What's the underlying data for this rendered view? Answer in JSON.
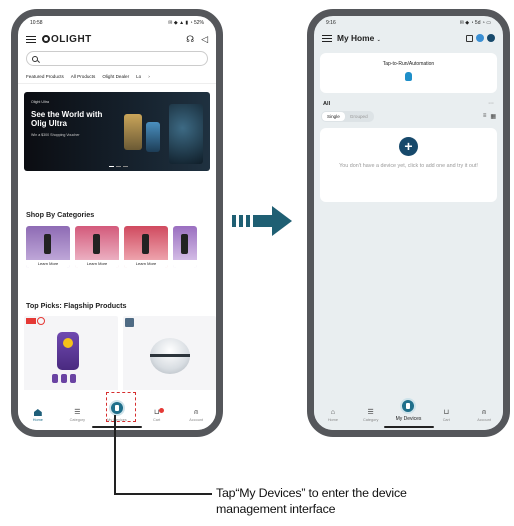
{
  "left_phone": {
    "status": {
      "time": "10:58",
      "icons": "✉ ◆ ▲ ▮ ◔ 52%"
    },
    "logo": "OLIGHT",
    "tabs": [
      "Featured Products",
      "All Products",
      "Olight Dealer",
      "Lo"
    ],
    "banner": {
      "brand": "Olight Ultra",
      "title": "See the World with Olig Ultra",
      "subtitle": "Win a $300 Shopping Voucher"
    },
    "shop_title": "Shop By Categories",
    "learn_more": "Learn More",
    "picks_title": "Top Picks: Flagship Products",
    "nav": [
      {
        "icon": "home-icon",
        "label": "Home"
      },
      {
        "icon": "category-icon",
        "label": "Category"
      },
      {
        "icon": "devices-icon",
        "label": "My Devices"
      },
      {
        "icon": "cart-icon",
        "label": "Cart"
      },
      {
        "icon": "account-icon",
        "label": "Account"
      }
    ]
  },
  "right_phone": {
    "status": {
      "time": "9:16",
      "icons": "✉ ◆ ◔ 5d ◔ ▭"
    },
    "title": "My Home",
    "tap_card_label": "Tap-to-Run/Automation",
    "all_label": "All",
    "more": "···",
    "segments": [
      "Single",
      "Grouped"
    ],
    "empty_text": "You don't have a device yet, click to add one and try it out!",
    "plus": "+",
    "nav": [
      {
        "icon": "home-icon",
        "label": "Home"
      },
      {
        "icon": "category-icon",
        "label": "Category"
      },
      {
        "icon": "devices-icon",
        "label": "My Devices"
      },
      {
        "icon": "cart-icon",
        "label": "Cart"
      },
      {
        "icon": "account-icon",
        "label": "Account"
      }
    ]
  },
  "annotation": {
    "line1": "Tap“My Devices” to enter the device",
    "line2": "management interface"
  },
  "colors": {
    "accent": "#1f6f8b",
    "arrow": "#1f5f73",
    "highlight": "#d62e2e"
  }
}
